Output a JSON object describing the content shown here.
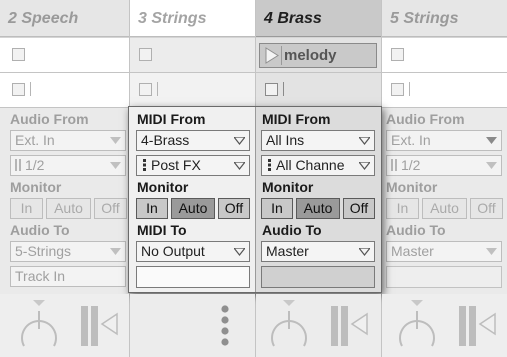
{
  "tracks": [
    {
      "name": "2 Speech"
    },
    {
      "name": "3 Strings"
    },
    {
      "name": "4 Brass"
    },
    {
      "name": "5 Strings"
    }
  ],
  "clip": {
    "name": "melody"
  },
  "left_track": {
    "audio_from_label": "Audio From",
    "audio_from_value": "Ext. In",
    "channel_value": "1/2",
    "monitor_label": "Monitor",
    "monitor_buttons": [
      "In",
      "Auto",
      "Off"
    ],
    "audio_to_label": "Audio To",
    "audio_to_value": "5-Strings",
    "track_in_value": "Track In"
  },
  "midi_track_3": {
    "midi_from_label": "MIDI From",
    "midi_from_value": "4-Brass",
    "channel_value": "Post FX",
    "monitor_label": "Monitor",
    "monitor_buttons": [
      "In",
      "Auto",
      "Off"
    ],
    "midi_to_label": "MIDI To",
    "midi_to_value": "No Output"
  },
  "midi_track_4": {
    "midi_from_label": "MIDI From",
    "midi_from_value": "All Ins",
    "channel_value": "All Channe",
    "monitor_label": "Monitor",
    "monitor_buttons": [
      "In",
      "Auto",
      "Off"
    ],
    "audio_to_label": "Audio To",
    "audio_to_value": "Master"
  },
  "right_track": {
    "audio_from_label": "Audio From",
    "audio_from_value": "Ext. In",
    "channel_value": "1/2",
    "monitor_label": "Monitor",
    "monitor_buttons": [
      "In",
      "Auto",
      "Off"
    ],
    "audio_to_label": "Audio To",
    "audio_to_value": "Master"
  },
  "icons": [
    "dropdown-arrow-icon",
    "play-icon",
    "stop-slot-icon",
    "pan-knob-icon",
    "level-meter-icon",
    "more-dots-icon"
  ]
}
